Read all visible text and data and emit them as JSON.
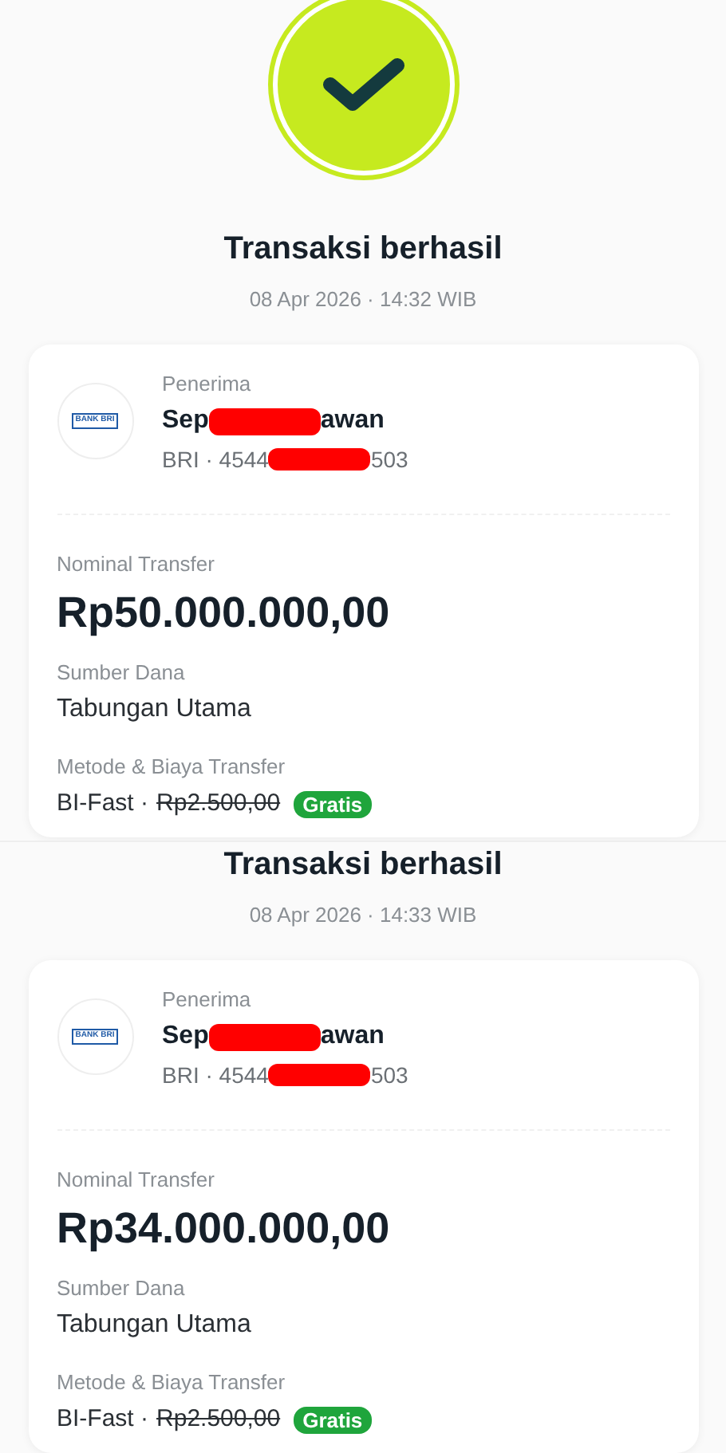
{
  "receipts": [
    {
      "show_success_icon": true,
      "title": "Transaksi berhasil",
      "datetime": "08 Apr 2026 · 14:32 WIB",
      "recipient": {
        "label": "Penerima",
        "bank_logo_text": "BANK BRI",
        "name_start": "Sep",
        "name_end": "awan",
        "account_start": "BRI · 4544",
        "account_end": "503"
      },
      "amount_label": "Nominal Transfer",
      "amount": "Rp50.000.000,00",
      "source_label": "Sumber Dana",
      "source": "Tabungan Utama",
      "method_label": "Metode & Biaya Transfer",
      "method": "BI-Fast ·",
      "original_fee": "Rp2.500,00",
      "fee_badge": "Gratis"
    },
    {
      "show_success_icon": false,
      "title": "Transaksi berhasil",
      "datetime": "08 Apr 2026 · 14:33 WIB",
      "recipient": {
        "label": "Penerima",
        "bank_logo_text": "BANK BRI",
        "name_start": "Sep",
        "name_end": "awan",
        "account_start": "BRI · 4544",
        "account_end": "503"
      },
      "amount_label": "Nominal Transfer",
      "amount": "Rp34.000.000,00",
      "source_label": "Sumber Dana",
      "source": "Tabungan Utama",
      "method_label": "Metode & Biaya Transfer",
      "method": "BI-Fast ·",
      "original_fee": "Rp2.500,00",
      "fee_badge": "Gratis"
    }
  ]
}
